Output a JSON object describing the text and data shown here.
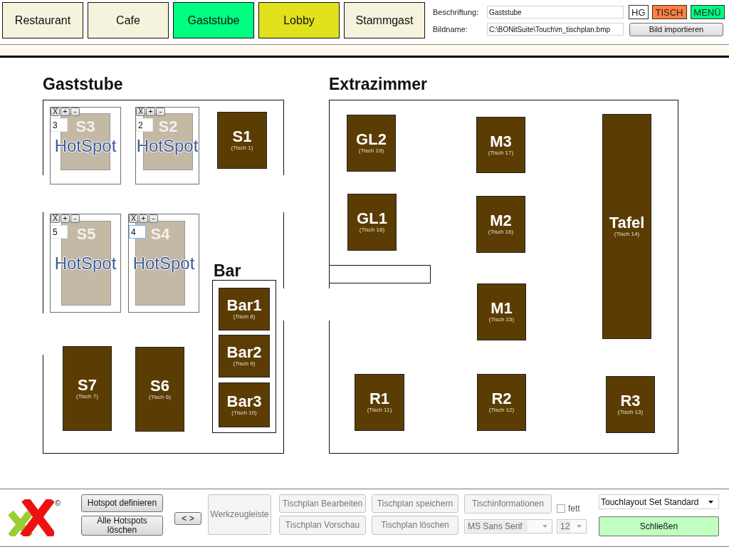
{
  "tabs": [
    {
      "label": "Restaurant",
      "color": "#f5f3dc"
    },
    {
      "label": "Cafe",
      "color": "#f5f3dc"
    },
    {
      "label": "Gaststube",
      "color": "#00ff80"
    },
    {
      "label": "Lobby",
      "color": "#e1e11e"
    },
    {
      "label": "Stammgast",
      "color": "#f5f3dc"
    }
  ],
  "caption_field": {
    "label": "Beschriftung:",
    "value": "Gaststube"
  },
  "image_field": {
    "label": "Bildname:",
    "value": "C:\\BONitSuite\\Touch\\m_tischplan.bmp"
  },
  "color_buttons": [
    {
      "label": "HG",
      "color": "#ffffff"
    },
    {
      "label": "TISCH",
      "color": "#ff8040"
    },
    {
      "label": "MENÜ",
      "color": "#00ff80"
    }
  ],
  "import_button": {
    "label": "Bild importieren"
  },
  "rooms": [
    {
      "title": "Gaststube",
      "tables": [
        {
          "kind": "hotspot",
          "name": "S3",
          "number": "3",
          "label": "HotSpot",
          "controls": [
            "X",
            "+",
            "-"
          ],
          "focused": false
        },
        {
          "kind": "hotspot",
          "name": "S2",
          "number": "2",
          "label": "HotSpot",
          "controls": [
            "X",
            "+",
            "-"
          ],
          "focused": false
        },
        {
          "kind": "table",
          "name": "S1",
          "caption": "(Tisch 1)"
        },
        {
          "kind": "hotspot",
          "name": "S5",
          "number": "5",
          "label": "HotSpot",
          "controls": [
            "X",
            "+",
            "-"
          ],
          "focused": false
        },
        {
          "kind": "hotspot",
          "name": "S4",
          "number": "4",
          "label": "HotSpot",
          "controls": [
            "X",
            "+",
            "-"
          ],
          "focused": true
        },
        {
          "kind": "table",
          "name": "S7",
          "caption": "(Tisch 7)"
        },
        {
          "kind": "table",
          "name": "S6",
          "caption": "(Tisch 6)"
        }
      ]
    },
    {
      "title": "Bar",
      "tables": [
        {
          "kind": "table",
          "name": "Bar1",
          "caption": "(Tisch 8)"
        },
        {
          "kind": "table",
          "name": "Bar2",
          "caption": "(Tisch 9)"
        },
        {
          "kind": "table",
          "name": "Bar3",
          "caption": "(Tisch 10)"
        }
      ]
    },
    {
      "title": "Extrazimmer",
      "tables": [
        {
          "kind": "table",
          "name": "GL2",
          "caption": "(Tisch 19)"
        },
        {
          "kind": "table",
          "name": "M3",
          "caption": "(Tisch 17)"
        },
        {
          "kind": "table",
          "name": "GL1",
          "caption": "(Tisch 18)"
        },
        {
          "kind": "table",
          "name": "M2",
          "caption": "(Tisch 16)"
        },
        {
          "kind": "table",
          "name": "Tafel",
          "caption": "(Tisch 14)"
        },
        {
          "kind": "table",
          "name": "M1",
          "caption": "(Tisch 15)"
        },
        {
          "kind": "table",
          "name": "R1",
          "caption": "(Tisch 11)"
        },
        {
          "kind": "table",
          "name": "R2",
          "caption": "(Tisch 12)"
        },
        {
          "kind": "table",
          "name": "R3",
          "caption": "(Tisch 13)"
        }
      ]
    }
  ],
  "toolbar": {
    "copyright": "©",
    "hotspot_buttons": [
      {
        "label": "Hotspot definieren",
        "disabled": false
      },
      {
        "label": "Alle Hotspots löschen",
        "disabled": false
      }
    ],
    "toggle_button": {
      "label": "< >",
      "disabled": false
    },
    "tool_button": {
      "label": "Werkzeugleiste",
      "disabled": true
    },
    "plan_buttons": [
      {
        "label": "Tischplan Bearbeiten",
        "disabled": true
      },
      {
        "label": "Tischplan Vorschau",
        "disabled": true
      },
      {
        "label": "Tischplan speichern",
        "disabled": true
      },
      {
        "label": "Tischplan löschen",
        "disabled": true
      }
    ],
    "info_button": {
      "label": "Tischinformationen",
      "disabled": true
    },
    "bold_checkbox": {
      "label": "fett",
      "checked": false
    },
    "font_select": {
      "value": "MS Sans Serif",
      "disabled": true
    },
    "size_select": {
      "value": "12",
      "disabled": true
    },
    "layout_select": {
      "value": "Touchlayout Set Standard"
    },
    "close_button": {
      "label": "Schließen"
    }
  }
}
